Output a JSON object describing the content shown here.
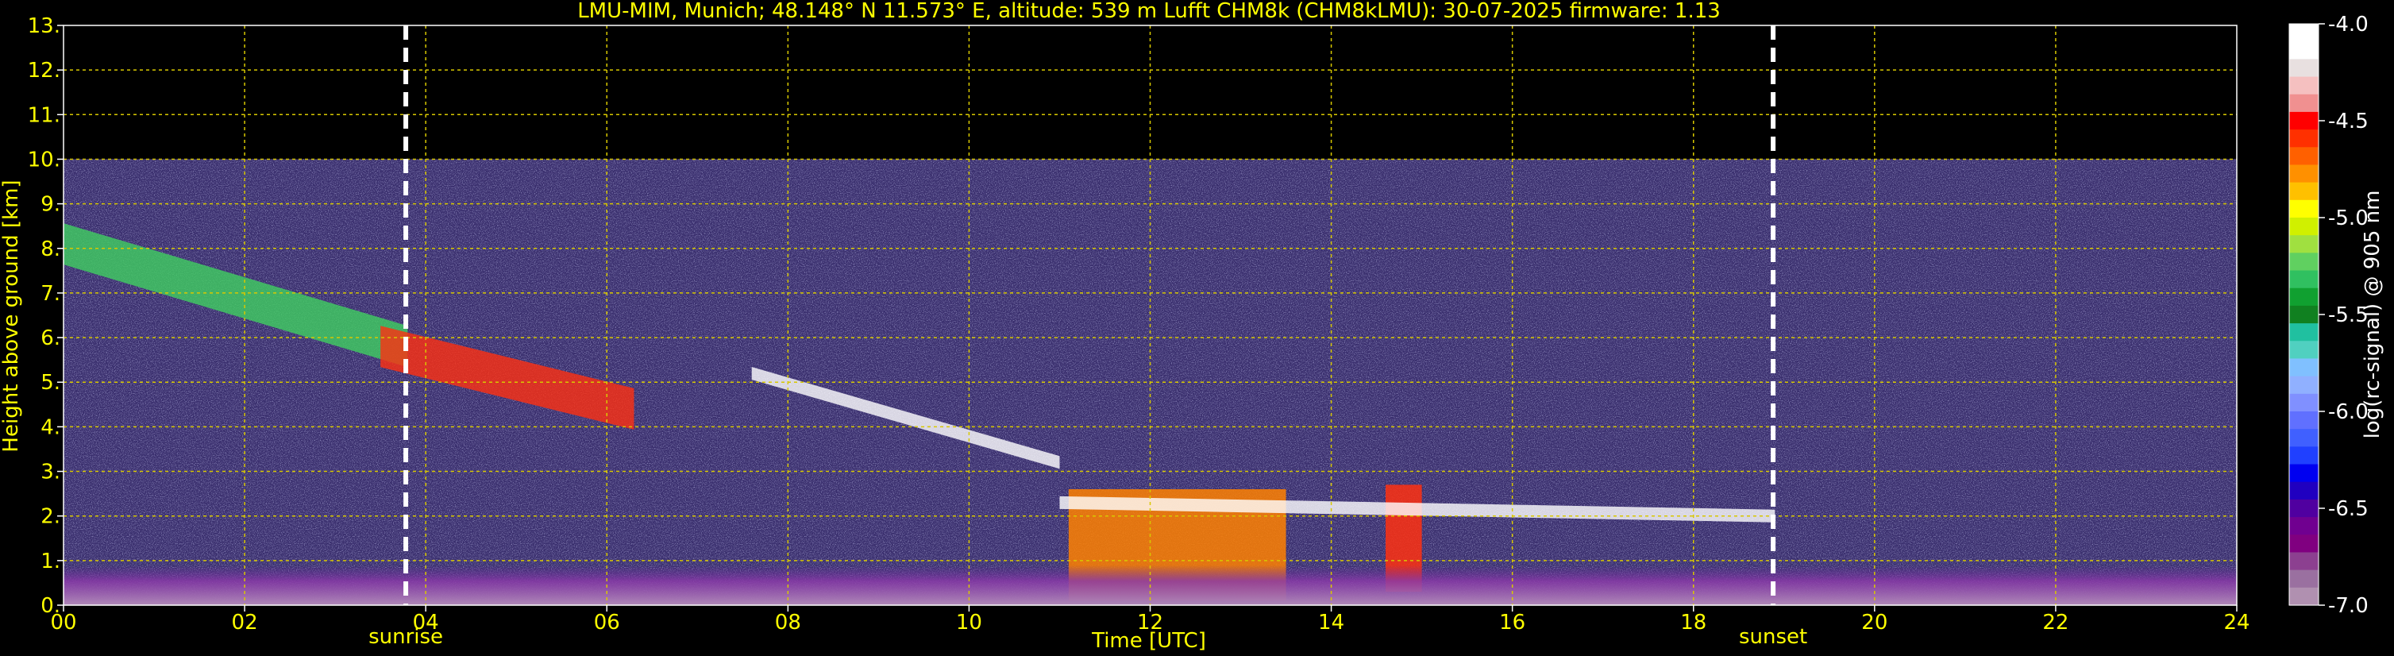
{
  "chart_data": {
    "type": "heatmap",
    "title": "LMU-MIM, Munich; 48.148° N 11.573° E, altitude: 539 m    Lufft CHM8k (CHM8kLMU): 30-07-2025    firmware: 1.13",
    "xlabel": "Time [UTC]",
    "ylabel": "Height above ground [km]",
    "xlim": [
      0,
      24
    ],
    "ylim": [
      0,
      13
    ],
    "x_ticks": [
      {
        "value": 0,
        "label": "00"
      },
      {
        "value": 2,
        "label": "02"
      },
      {
        "value": 4,
        "label": "04"
      },
      {
        "value": 6,
        "label": "06"
      },
      {
        "value": 8,
        "label": "08"
      },
      {
        "value": 10,
        "label": "10"
      },
      {
        "value": 12,
        "label": "12"
      },
      {
        "value": 14,
        "label": "14"
      },
      {
        "value": 16,
        "label": "16"
      },
      {
        "value": 18,
        "label": "18"
      },
      {
        "value": 20,
        "label": "20"
      },
      {
        "value": 22,
        "label": "22"
      },
      {
        "value": 24,
        "label": "24"
      }
    ],
    "y_ticks": [
      {
        "value": 0,
        "label": "0."
      },
      {
        "value": 1,
        "label": "1."
      },
      {
        "value": 2,
        "label": "2."
      },
      {
        "value": 3,
        "label": "3."
      },
      {
        "value": 4,
        "label": "4."
      },
      {
        "value": 5,
        "label": "5."
      },
      {
        "value": 6,
        "label": "6."
      },
      {
        "value": 7,
        "label": "7."
      },
      {
        "value": 8,
        "label": "8."
      },
      {
        "value": 9,
        "label": "9."
      },
      {
        "value": 10,
        "label": "10."
      },
      {
        "value": 11,
        "label": "11."
      },
      {
        "value": 12,
        "label": "12."
      },
      {
        "value": 13,
        "label": "13."
      }
    ],
    "grid": true,
    "data_ceiling_km": 10,
    "events": [
      {
        "label": "sunrise",
        "time_utc": 3.78
      },
      {
        "label": "sunset",
        "time_utc": 18.88
      }
    ],
    "features": [
      {
        "kind": "cirrus",
        "t0": 0.0,
        "t1": 3.8,
        "h0": 8.1,
        "h1": 5.8,
        "color": "#40d060"
      },
      {
        "kind": "cirrus",
        "t0": 3.5,
        "t1": 6.3,
        "h0": 5.8,
        "h1": 4.4,
        "color": "#ff3010"
      },
      {
        "kind": "cloud-layer",
        "t0": 7.6,
        "t1": 11.0,
        "h0": 5.2,
        "h1": 3.2,
        "color": "#ffffff"
      },
      {
        "kind": "cumulus",
        "t0": 11.1,
        "t1": 13.5,
        "h0": 0.1,
        "h1": 2.6,
        "color": "#ff8000"
      },
      {
        "kind": "cumulus",
        "t0": 14.6,
        "t1": 15.0,
        "h0": 0.3,
        "h1": 2.7,
        "color": "#ff3010"
      },
      {
        "kind": "boundary-layer-top",
        "t0": 11.0,
        "t1": 18.9,
        "h0": 2.3,
        "h1": 2.0,
        "color": "#ffffff"
      },
      {
        "kind": "aerosol",
        "t0": 0.0,
        "t1": 24.0,
        "h0": 0.0,
        "h1": 0.9,
        "color": "#a040c0"
      }
    ],
    "colorbar": {
      "label": "log(rc-signal) @ 905 nm",
      "range": [
        -7.0,
        -4.0
      ],
      "tick_values": [
        -4.0,
        -4.5,
        -5.0,
        -5.5,
        -6.0,
        -6.5,
        -7.0
      ],
      "tick_labels": [
        "-4.0",
        "-4.5",
        "-5.0",
        "-5.5",
        "-6.0",
        "-6.5",
        "-7.0"
      ],
      "colors_top_to_bottom": [
        "#ffffff",
        "#ffffff",
        "#e8e0e0",
        "#f5c0c0",
        "#f09090",
        "#ff0000",
        "#ff3000",
        "#ff6000",
        "#ff9000",
        "#ffc000",
        "#ffff00",
        "#d0f000",
        "#a0e040",
        "#60d060",
        "#30c060",
        "#10a030",
        "#108020",
        "#20c0a0",
        "#50d0c0",
        "#80c0ff",
        "#90b0ff",
        "#8090ff",
        "#6070ff",
        "#4060ff",
        "#2040ff",
        "#0000f0",
        "#2000c0",
        "#5000a0",
        "#700090",
        "#800080",
        "#8c4090",
        "#9a70a0",
        "#b090b0"
      ]
    }
  },
  "colors": {
    "text": "#ffff00",
    "grid": "#d8c800",
    "event_line": "#ffffff",
    "clear_sky": "#000000",
    "noise_base": "#3a2f6e"
  }
}
